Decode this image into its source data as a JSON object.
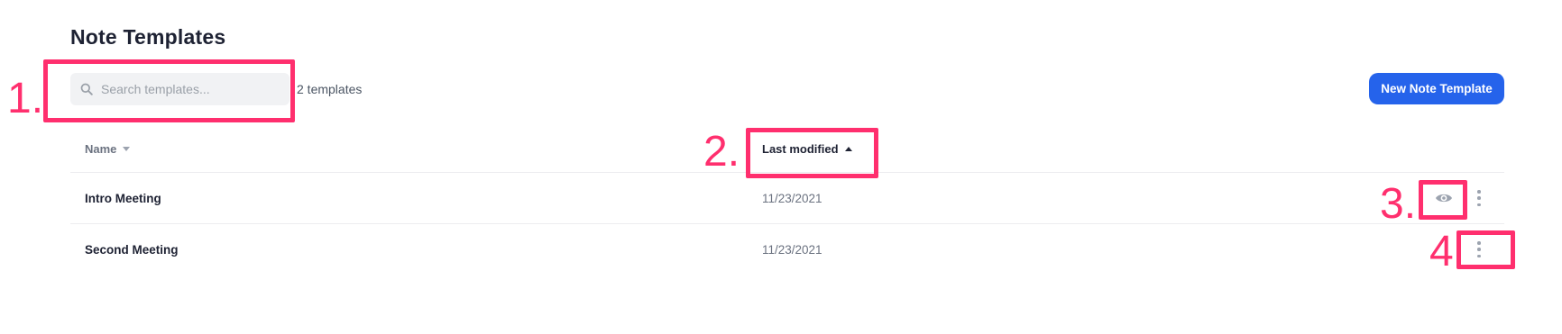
{
  "page": {
    "title": "Note Templates"
  },
  "search": {
    "placeholder": "Search templates...",
    "value": ""
  },
  "template_count": "2 templates",
  "new_button_label": "New Note Template",
  "table": {
    "columns": [
      {
        "label": "Name",
        "sort": "none"
      },
      {
        "label": "Last modified",
        "sort": "ascending"
      }
    ],
    "rows": [
      {
        "name": "Intro Meeting",
        "modified": "11/23/2021"
      },
      {
        "name": "Second Meeting",
        "modified": "11/23/2021"
      }
    ]
  },
  "annotations": [
    "1.",
    "2.",
    "3.",
    "4"
  ],
  "colors": {
    "accent": "#2563eb",
    "annotation": "#ff2f6e",
    "muted": "#6b7280"
  },
  "icons": {
    "search": "search-icon",
    "view": "eye-icon",
    "more": "more-vertical-icon"
  }
}
